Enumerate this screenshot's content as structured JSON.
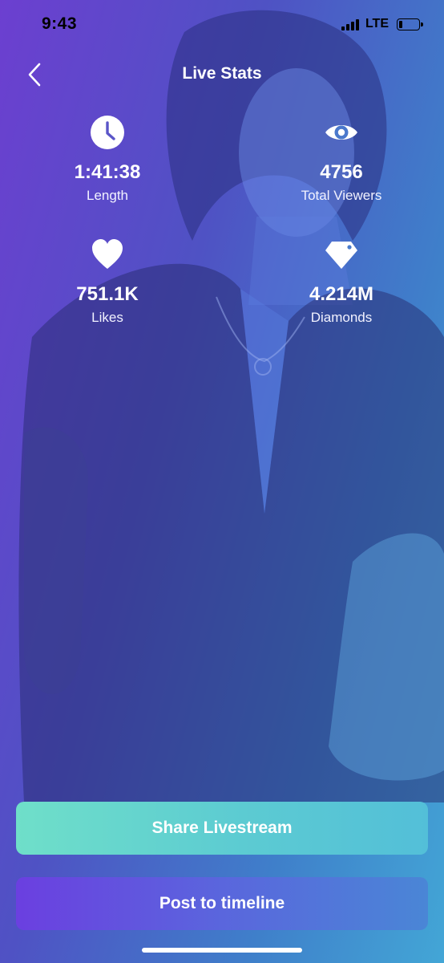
{
  "status_bar": {
    "time": "9:43",
    "network": "LTE",
    "battery_level": 0.2
  },
  "header": {
    "back_icon": "chevron-left-icon",
    "title": "Live Stats"
  },
  "stats": [
    {
      "icon": "clock-icon",
      "value": "1:41:38",
      "label": "Length"
    },
    {
      "icon": "eye-icon",
      "value": "4756",
      "label": "Total Viewers"
    },
    {
      "icon": "heart-icon",
      "value": "751.1K",
      "label": "Likes"
    },
    {
      "icon": "diamond-icon",
      "value": "4.214M",
      "label": "Diamonds"
    }
  ],
  "actions": {
    "share_label": "Share Livestream",
    "post_label": "Post to timeline"
  },
  "colors": {
    "background_start": "#6c3fd0",
    "background_end": "#43a6d6",
    "share_button": "#5ccbd2",
    "post_button": "#5a66dd"
  }
}
